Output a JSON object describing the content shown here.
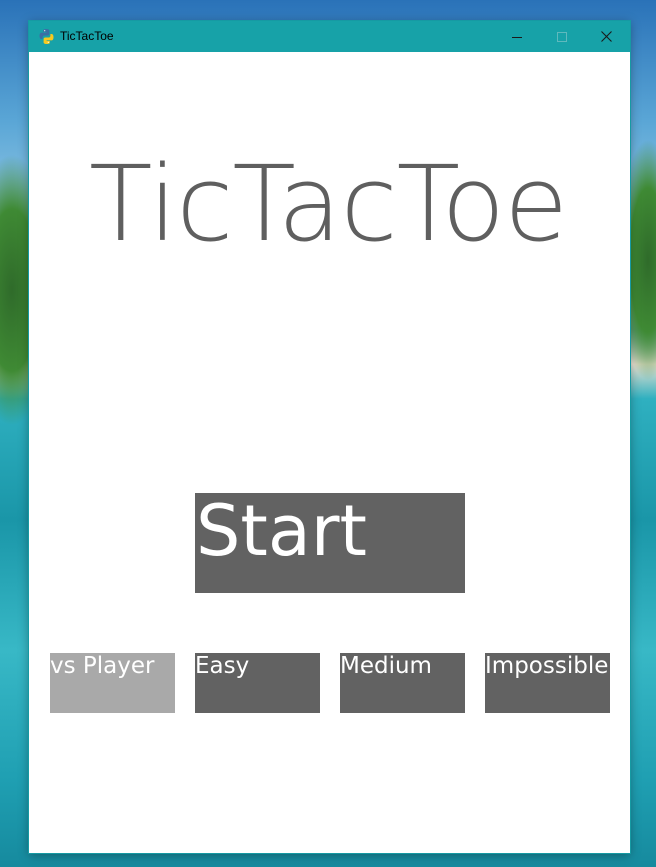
{
  "window": {
    "title": "TicTacToe",
    "icon": "python-icon",
    "controls": [
      "minimize-icon",
      "maximize-icon",
      "close-icon"
    ],
    "titlebar_color": "#17a2a8"
  },
  "game": {
    "title": "TicTacToe",
    "start_label": "Start",
    "modes": [
      {
        "label": "vs Player",
        "selected": true
      },
      {
        "label": "Easy",
        "selected": false
      },
      {
        "label": "Medium",
        "selected": false
      },
      {
        "label": "Impossible",
        "selected": false
      }
    ],
    "colors": {
      "button": "#626262",
      "selected_button": "#a9a9a9",
      "title_text": "#5f5f5f",
      "button_text": "#ffffff"
    }
  }
}
